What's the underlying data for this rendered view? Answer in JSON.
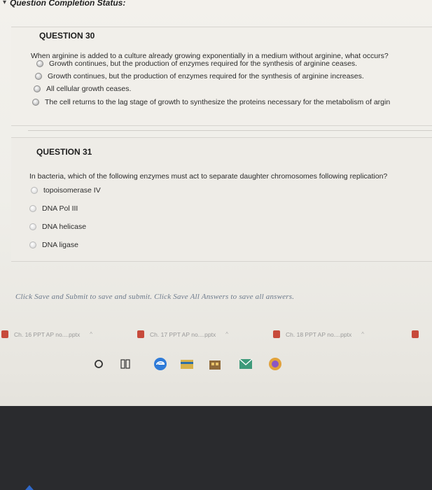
{
  "header": {
    "title": "Question Completion Status:"
  },
  "questions": [
    {
      "number": "QUESTION 30",
      "text": "When arginine is added to a culture already growing exponentially in a medium without arginine, what occurs?",
      "options": [
        "Growth continues, but the production of enzymes required for the synthesis of arginine ceases.",
        "Growth continues, but the production of enzymes required for the synthesis of arginine increases.",
        "All cellular growth ceases.",
        "The cell returns to the lag stage of growth to synthesize the proteins necessary for the metabolism of argin"
      ]
    },
    {
      "number": "QUESTION 31",
      "text": "In bacteria, which of the following enzymes must act to separate daughter chromosomes following replication?",
      "options": [
        "topoisomerase IV",
        "DNA Pol III",
        "DNA helicase",
        "DNA ligase"
      ]
    }
  ],
  "footer": {
    "note": "Click Save and Submit to save and submit. Click Save All Answers to save all answers."
  },
  "downloads": [
    {
      "name": "Ch. 16 PPT AP no....pptx"
    },
    {
      "name": "Ch. 17 PPT AP no....pptx"
    },
    {
      "name": "Ch. 18 PPT AP no....pptx"
    }
  ],
  "colors": {
    "accent_red": "#c74a3b",
    "link_blue": "#6d7b8c"
  }
}
